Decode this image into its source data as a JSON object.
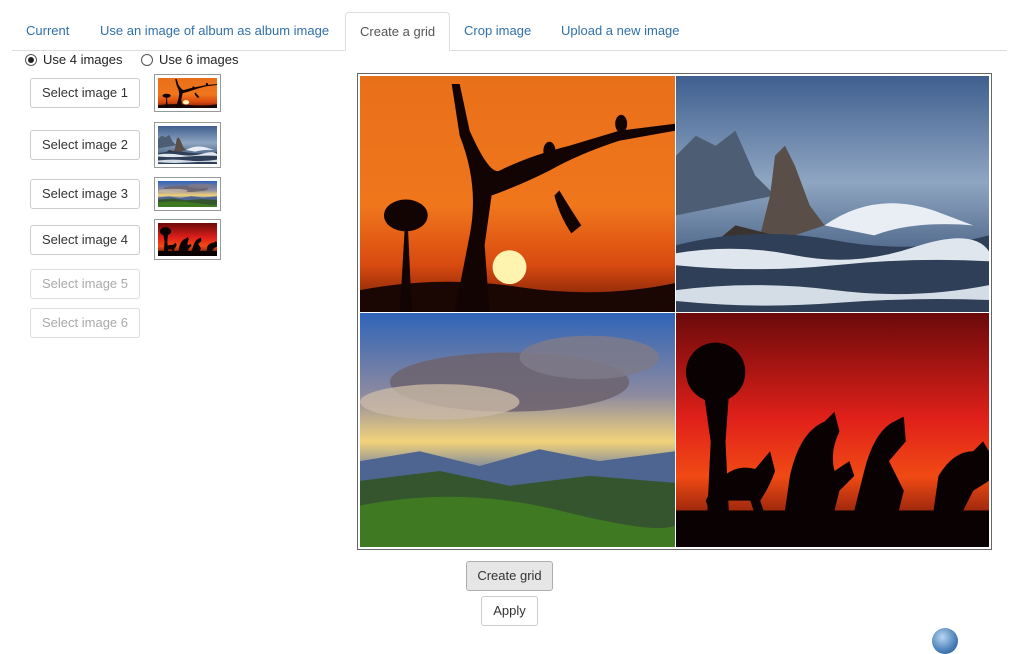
{
  "tabs": [
    {
      "label": "Current",
      "active": false
    },
    {
      "label": "Use an image of album as album image",
      "active": false
    },
    {
      "label": "Create a grid",
      "active": true
    },
    {
      "label": "Crop image",
      "active": false
    },
    {
      "label": "Upload a new image",
      "active": false
    }
  ],
  "grid_options": {
    "four": {
      "label": "Use 4 images",
      "selected": true
    },
    "six": {
      "label": "Use 6 images",
      "selected": false
    }
  },
  "select_buttons": [
    {
      "label": "Select image 1",
      "enabled": true,
      "thumbnail": "sunset-tree-birds"
    },
    {
      "label": "Select image 2",
      "enabled": true,
      "thumbnail": "coastal-rocks-waves"
    },
    {
      "label": "Select image 3",
      "enabled": true,
      "thumbnail": "sun-rays-mountains"
    },
    {
      "label": "Select image 4",
      "enabled": true,
      "thumbnail": "horses-red-sunset"
    },
    {
      "label": "Select image 5",
      "enabled": false
    },
    {
      "label": "Select image 6",
      "enabled": false
    }
  ],
  "preview": {
    "cells": [
      "sunset-tree-birds",
      "coastal-rocks-waves",
      "sun-rays-mountains",
      "horses-red-sunset"
    ]
  },
  "actions": {
    "create_grid": "Create grid",
    "apply": "Apply"
  },
  "colors": {
    "link": "#2f70a9",
    "border": "#dddddd"
  }
}
